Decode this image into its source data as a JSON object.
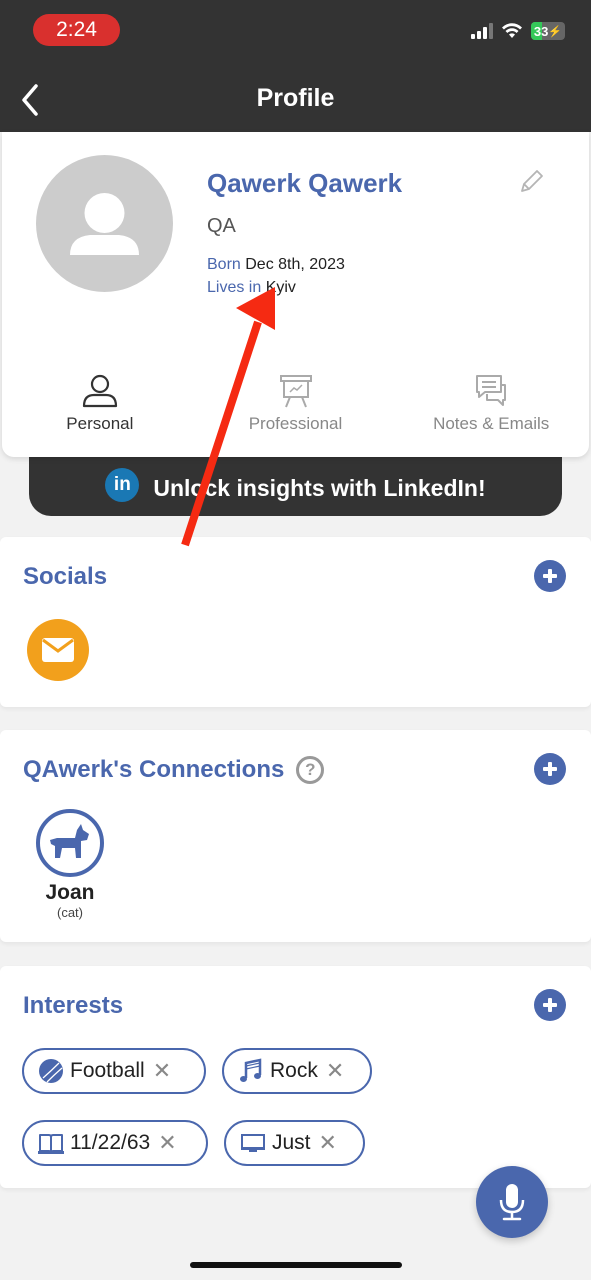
{
  "status_bar": {
    "time": "2:24",
    "battery": "33",
    "battery_level_percent": 33
  },
  "header": {
    "title": "Profile",
    "back_icon": "chevron-left-icon"
  },
  "profile": {
    "name": "Qawerk Qawerk",
    "role": "QA",
    "born_label": "Born",
    "born_value": "Dec 8th, 2023",
    "lives_label": "Lives in",
    "lives_value": "Kyiv",
    "edit_icon": "pencil-icon",
    "avatar_icon": "person-icon"
  },
  "tabs": [
    {
      "label": "Personal",
      "icon": "person-outline-icon",
      "active": true
    },
    {
      "label": "Professional",
      "icon": "presentation-icon",
      "active": false
    },
    {
      "label": "Notes & Emails",
      "icon": "chat-bubbles-icon",
      "active": false
    }
  ],
  "linkedin_banner": {
    "icon_text": "in",
    "text": "Unlock insights with LinkedIn!"
  },
  "socials": {
    "title": "Socials",
    "items": [
      {
        "icon": "email-icon"
      }
    ]
  },
  "connections": {
    "title": "QAwerk's Connections",
    "help_icon": "?",
    "items": [
      {
        "name": "Joan",
        "type": "(cat)",
        "icon": "dog-icon"
      }
    ]
  },
  "interests": {
    "title": "Interests",
    "items": [
      {
        "label": "Football",
        "icon": "ball-icon",
        "remove": "✕"
      },
      {
        "label": "Rock",
        "icon": "music-note-icon",
        "remove": "✕"
      },
      {
        "label": "11/22/63",
        "icon": "book-icon",
        "remove": "✕"
      },
      {
        "label": "Just",
        "icon": "tv-icon",
        "remove": "✕"
      }
    ]
  },
  "colors": {
    "accent": "#4a67ad",
    "header_bg": "#333333",
    "email_social": "#f2a01c",
    "linkedin": "#1a78b4",
    "time_pill": "#d9302e",
    "annotation_arrow": "#f52a12"
  }
}
